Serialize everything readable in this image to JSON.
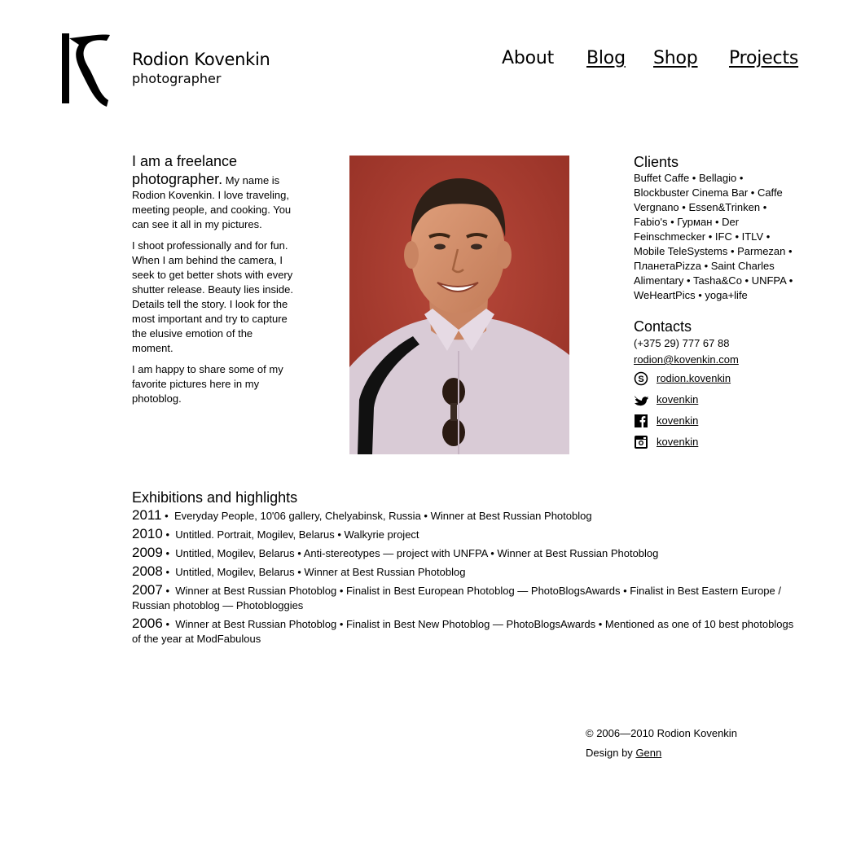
{
  "header": {
    "logo_letter": "R",
    "name": "Rodion Kovenkin",
    "tagline": "photographer",
    "nav": [
      {
        "label": "About"
      },
      {
        "label": "Blog"
      },
      {
        "label": "Shop"
      },
      {
        "label": "Projects"
      }
    ]
  },
  "intro": {
    "lead": "I am a freelance photographer.",
    "p1_rest": "My name is Rodion Kovenkin. I love traveling, meeting people, and cooking. You can see it all in my pictures.",
    "p2": "I shoot professionally and for fun. When I am behind the camera, I seek to get better shots with every shutter release. Beauty lies inside. Details tell the story. I look for the most important and try to capture the elusive emotion of the moment.",
    "p3": "I am happy to share some of my favorite pictures here in my photoblog."
  },
  "clients": {
    "title": "Clients",
    "text": "Buffet Caffe • Bellagio • Blockbuster Cinema Bar • Caffe Vergnano • Essen&Trinken • Fabio's • Гурман • Der Feinschmecker • IFC • ITLV • Mobile TeleSystems • Parmezan • ПланетаPizza • Saint Charles Alimentary • Tasha&Co • UNFPA • WeHeartPics • yoga+life"
  },
  "contacts": {
    "title": "Contacts",
    "phone": "(+375 29) 777 67 88",
    "email": "rodion@kovenkin.com",
    "skype": "rodion.kovenkin",
    "twitter": "kovenkin",
    "facebook": "kovenkin",
    "instagram": "kovenkin"
  },
  "exhibitions": {
    "title": "Exhibitions and highlights",
    "rows": [
      {
        "year": "2011",
        "text": "Everyday People, 10'06 gallery, Chelyabinsk, Russia • Winner at Best Russian Photoblog"
      },
      {
        "year": "2010",
        "text": "Untitled. Portrait, Mogilev, Belarus • Walkyrie project"
      },
      {
        "year": "2009",
        "text": "Untitled, Mogilev, Belarus • Anti-stereotypes — project with UNFPA • Winner at Best Russian Photoblog"
      },
      {
        "year": "2008",
        "text": "Untitled, Mogilev, Belarus • Winner at Best Russian Photoblog"
      },
      {
        "year": "2007",
        "text": "Winner at Best Russian Photoblog • Finalist in Best European Photoblog — PhotoBlogsAwards • Finalist in Best Eastern Europe / Russian photoblog — Photobloggies"
      },
      {
        "year": "2006",
        "text": "Winner at Best Russian Photoblog • Finalist in Best New Photoblog — PhotoBlogsAwards • Mentioned as one of 10 best photoblogs of the year at ModFabulous"
      }
    ]
  },
  "footer": {
    "copyright": "© 2006—2010 Rodion Kovenkin",
    "design_prefix": "Design by",
    "designer": "Genn"
  },
  "colors": {
    "text": "#000000",
    "background": "#ffffff",
    "portrait_bg": "#a8392a",
    "shirt": "#d9cbd6"
  }
}
